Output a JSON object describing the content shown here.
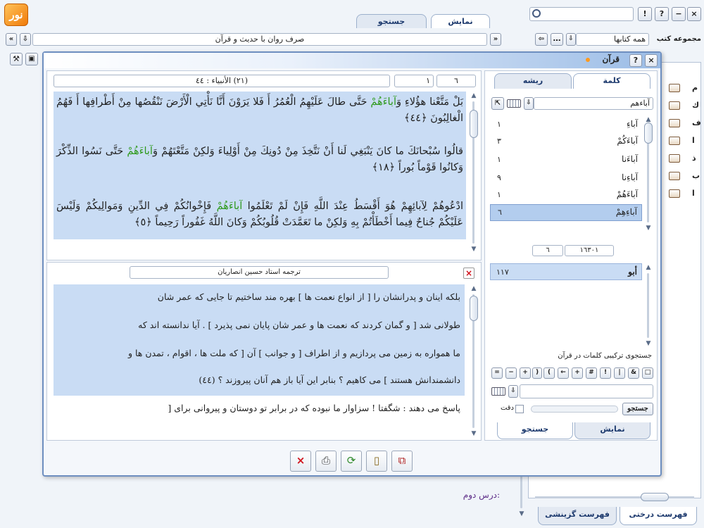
{
  "app": {
    "top_tabs": [
      "نمایش",
      "جستجو"
    ],
    "address_bar": "صرف روان با حدیث و قرآن",
    "collection_label": "مجموعه کتب",
    "collection_value": "همه کتابها",
    "search_placeholder": "",
    "lesson_text": "درس دوم:",
    "bottom_tabs": [
      "فهرست درختی",
      "فهرست گزینشی"
    ],
    "tree_letters": [
      "م",
      "ك",
      "ف",
      "ا",
      "ذ",
      "ب",
      "ا"
    ]
  },
  "quran_window": {
    "title": "قرآن",
    "close_glyph": "×",
    "help_glyph": "?",
    "nav": {
      "sura_label": "(٢١) الأنبياء : ٤٤",
      "verse_input": "١",
      "page_input": "٦"
    },
    "verses": [
      "بَلْ مَتَّعْنا هؤُلاءِ وَآباءَهُمْ حَتَّى طالَ عَلَيْهِمُ الْعُمُرُ أَ فَلا يَرَوْنَ أَنَّا نَأْتِي الْأَرْضَ نَنْقُصُها مِنْ أَطْرافِها أَ فَهُمُ الْغالِبُونَ ﴿٤٤﴾",
      "قالُوا سُبْحانَكَ ما كانَ يَنْبَغِي لَنا أَنْ نَتَّخِذَ مِنْ دُونِكَ مِنْ أَوْلِياءَ وَلكِنْ مَتَّعْتَهُمْ وَآباءَهُمْ حَتَّى نَسُوا الذِّكْرَ وَكانُوا قَوْماً بُوراً ﴿١٨﴾",
      "ادْعُوهُمْ لِآبائِهِمْ هُوَ أَقْسَطُ عِنْدَ اللَّهِ فَإِنْ لَمْ تَعْلَمُوا آباءَهُمْ فَإِخْوانُكُمْ فِي الدِّينِ وَمَوالِيكُمْ وَلَيْسَ عَلَيْكُمْ جُناحٌ فِيما أَخْطَأْتُمْ بِهِ وَلكِنْ ما تَعَمَّدَتْ قُلُوبُكُمْ وَكانَ اللَّهُ غَفُوراً رَحِيماً ﴿٥﴾"
    ],
    "highlight_word": "آباءَهُمْ",
    "translation_title": "ترجمه استاد حسين انصاريان",
    "translation_lines": [
      "بلکه اينان و پدرانشان را [ از انواع نعمت ها ] بهره مند ساختيم تا جايی که عمر شان",
      "طولانی شد [ و گمان کردند که نعمت ها و عمر شان پايان نمی پذيرد ] . آيا ندانسته اند که",
      "ما همواره به زمين می پردازيم و از اطراف [ و جوانب ] آن [ که ملت ها ، اقوام ، تمدن ها و",
      "دانشمندانش هستند ] می کاهيم ؟ بنابر اين آيا باز هم آنان پيروزند ؟ (٤٤)",
      "پاسخ می دهند : شگفتا ! سزاوار ما نبوده که در برابر تو دوستان و پيروانی برای ["
    ],
    "side_tabs": [
      "كلمة",
      "ريشه"
    ],
    "search_word": "آباءهم",
    "word_list": [
      {
        "word": "آباءِ",
        "count": "١"
      },
      {
        "word": "آباءَكُمْ",
        "count": "٣"
      },
      {
        "word": "آباءَنا",
        "count": "١"
      },
      {
        "word": "آباءِنا",
        "count": "٩"
      },
      {
        "word": "آباءَهُمْ",
        "count": "١"
      },
      {
        "word": "آباءِهِمْ",
        "count": "٦"
      }
    ],
    "counter_left": "٦",
    "counter_right": "١٦٣٠١",
    "root_list": [
      {
        "word": "أبو",
        "count": "١١٧"
      }
    ],
    "compound_label": "جستجوی ترکيبی کلمات در قرآن",
    "operators": [
      "□",
      "&",
      "|",
      "!",
      "#",
      "+",
      "←",
      "(",
      ")",
      "+",
      "−",
      "="
    ],
    "search_button": "جستجو",
    "precision_label": "دقت",
    "bottom_tabs": [
      "نمايش",
      "جستجو"
    ],
    "toolbar_icons": [
      "close-red",
      "print",
      "refresh",
      "page",
      "copy"
    ]
  },
  "colors": {
    "accent": "#ff9a1e",
    "panel_bg": "#c9dcf4",
    "highlight_green": "#2f9a1d",
    "selection_blue": "#b3cdee",
    "title_gradient_start": "#9bbce6"
  }
}
